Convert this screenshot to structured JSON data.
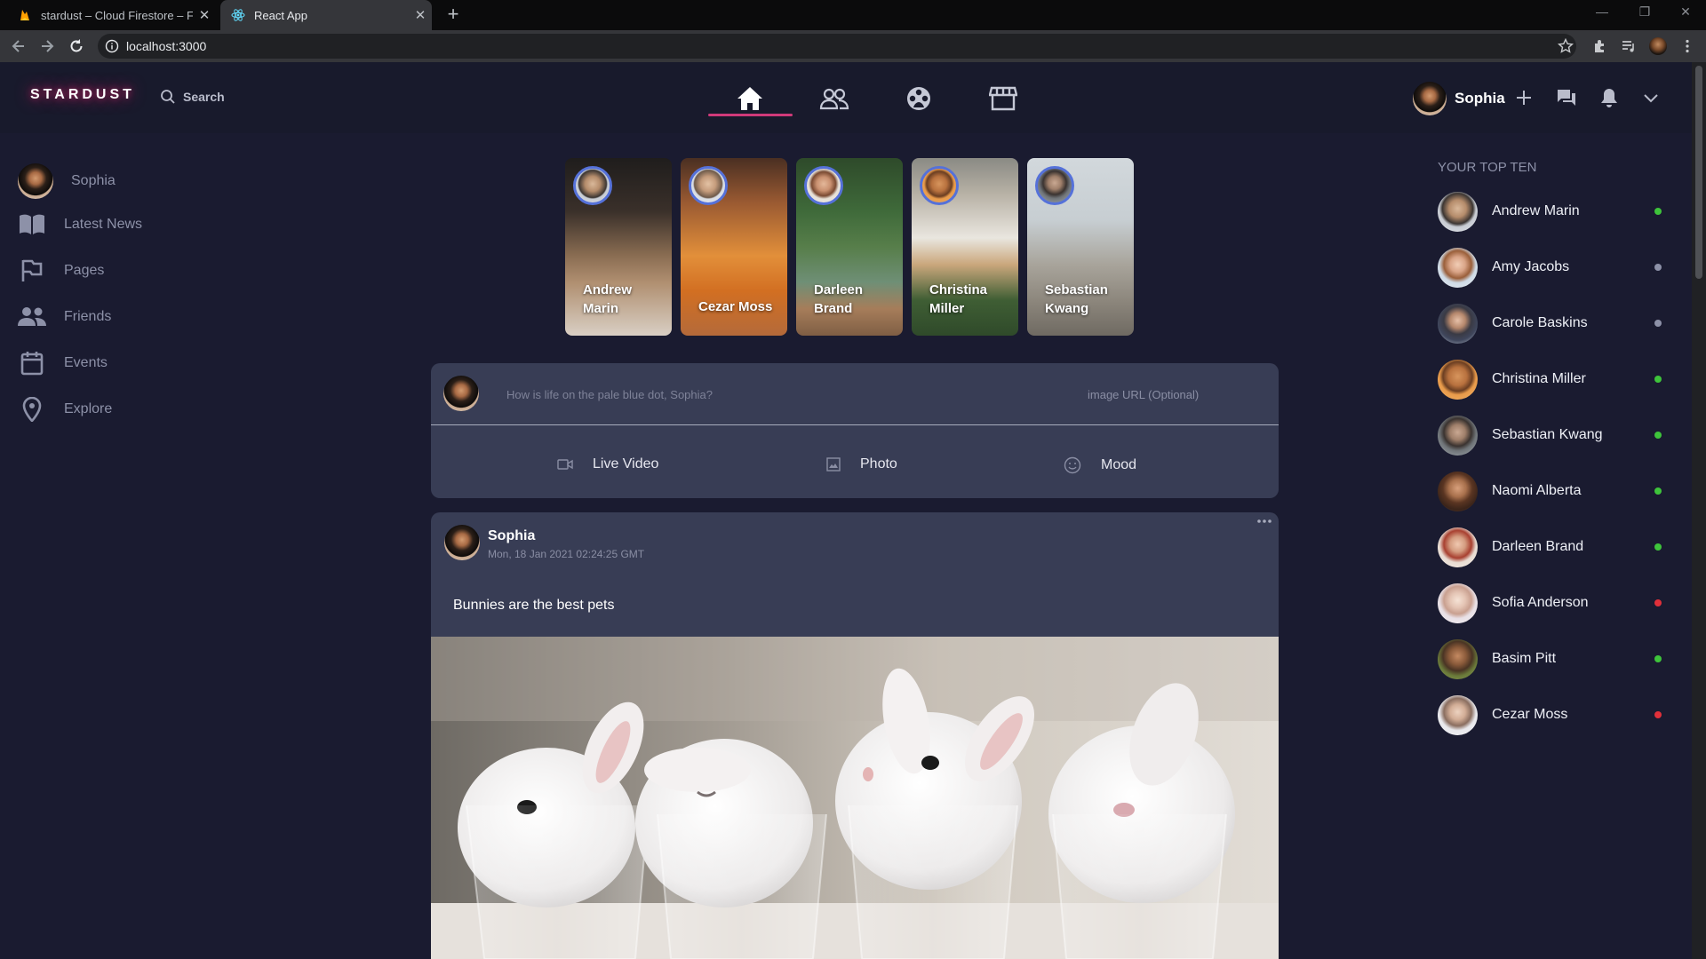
{
  "browser": {
    "tabs": [
      {
        "title": "stardust – Cloud Firestore – Fireb",
        "active": false,
        "icon": "firebase-flame-icon"
      },
      {
        "title": "React App",
        "active": true,
        "icon": "react-icon"
      }
    ],
    "url": "localhost:3000"
  },
  "header": {
    "logo": "STARDUST",
    "search_label": "Search",
    "nav": [
      "home-icon",
      "friends-icon",
      "groups-icon",
      "marketplace-icon"
    ],
    "active_nav": "home",
    "user_name": "Sophia"
  },
  "sidebar": {
    "profile_name": "Sophia",
    "items": [
      {
        "label": "Latest News",
        "icon": "book-icon"
      },
      {
        "label": "Pages",
        "icon": "flag-icon"
      },
      {
        "label": "Friends",
        "icon": "people-icon"
      },
      {
        "label": "Events",
        "icon": "calendar-icon"
      },
      {
        "label": "Explore",
        "icon": "location-pin-icon"
      }
    ]
  },
  "stories": [
    {
      "name_line1": "Andrew",
      "name_line2": "Marin"
    },
    {
      "name_line1": "Cezar Moss",
      "name_line2": ""
    },
    {
      "name_line1": "Darleen",
      "name_line2": "Brand"
    },
    {
      "name_line1": "Christina",
      "name_line2": "Miller"
    },
    {
      "name_line1": "Sebastian",
      "name_line2": "Kwang"
    }
  ],
  "composer": {
    "placeholder": "How is life on the pale blue dot, Sophia?",
    "image_placeholder": "image URL (Optional)",
    "actions": [
      {
        "label": "Live Video",
        "icon": "video-camera-icon"
      },
      {
        "label": "Photo",
        "icon": "image-icon"
      },
      {
        "label": "Mood",
        "icon": "smiley-icon"
      }
    ]
  },
  "post": {
    "author": "Sophia",
    "timestamp": "Mon, 18 Jan 2021 02:24:25 GMT",
    "text": "Bunnies are the best pets",
    "image": "photo of four white bunnies in drinking glasses"
  },
  "top_ten": {
    "title": "YOUR TOP TEN",
    "status_colors": {
      "online": "#3ec43b",
      "away": "#8d91a8",
      "busy": "#e0303a"
    },
    "people": [
      {
        "name": "Andrew Marin",
        "status": "online"
      },
      {
        "name": "Amy Jacobs",
        "status": "away"
      },
      {
        "name": "Carole Baskins",
        "status": "away"
      },
      {
        "name": "Christina Miller",
        "status": "online"
      },
      {
        "name": "Sebastian Kwang",
        "status": "online"
      },
      {
        "name": "Naomi Alberta",
        "status": "online"
      },
      {
        "name": "Darleen Brand",
        "status": "online"
      },
      {
        "name": "Sofia Anderson",
        "status": "busy"
      },
      {
        "name": "Basim Pitt",
        "status": "online"
      },
      {
        "name": "Cezar Moss",
        "status": "busy"
      }
    ]
  }
}
